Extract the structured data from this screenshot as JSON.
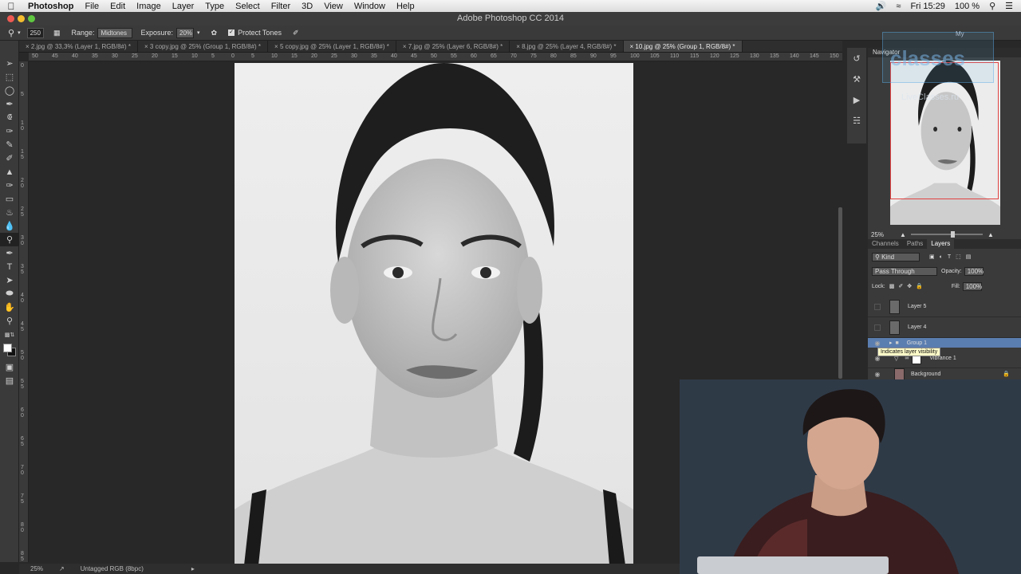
{
  "menubar": {
    "app": "Photoshop",
    "items": [
      "File",
      "Edit",
      "Image",
      "Layer",
      "Type",
      "Select",
      "Filter",
      "3D",
      "View",
      "Window",
      "Help"
    ],
    "clock": "Fri 15:29",
    "battery": "100 %"
  },
  "window": {
    "title": "Adobe Photoshop CC 2014"
  },
  "options": {
    "brush_size": "250",
    "range_label": "Range:",
    "range_value": "Midtones",
    "exposure_label": "Exposure:",
    "exposure_value": "20%",
    "protect_tones": "Protect Tones"
  },
  "tabs": [
    {
      "label": "2.jpg @ 33,3% (Layer 1, RGB/8#) *"
    },
    {
      "label": "3 copy.jpg @ 25% (Group 1, RGB/8#) *"
    },
    {
      "label": "5 copy.jpg @ 25% (Layer 1, RGB/8#) *"
    },
    {
      "label": "7.jpg @ 25% (Layer 6, RGB/8#) *"
    },
    {
      "label": "8.jpg @ 25% (Layer 4, RGB/8#) *"
    },
    {
      "label": "10.jpg @ 25% (Group 1, RGB/8#) *"
    }
  ],
  "ruler_h": [
    "50",
    "45",
    "40",
    "35",
    "30",
    "25",
    "20",
    "15",
    "10",
    "5",
    "0",
    "5",
    "10",
    "15",
    "20",
    "25",
    "30",
    "35",
    "40",
    "45",
    "50",
    "55",
    "60",
    "65",
    "70",
    "75",
    "80",
    "85",
    "90",
    "95",
    "100",
    "105",
    "110",
    "115",
    "120",
    "125",
    "130",
    "135",
    "140",
    "145",
    "150"
  ],
  "ruler_v": [
    "0",
    "5",
    "1 0",
    "1 5",
    "2 0",
    "2 5",
    "3 0",
    "3 5",
    "4 0",
    "4 5",
    "5 0",
    "5 5",
    "6 0",
    "6 5",
    "7 0",
    "7 5",
    "8 0",
    "8 5"
  ],
  "status": {
    "zoom": "25%",
    "profile": "Untagged RGB (8bpc)"
  },
  "navigator": {
    "title": "Navigator",
    "zoom": "25%"
  },
  "panel_tabs": [
    "Channels",
    "Paths",
    "Layers"
  ],
  "layers_panel": {
    "filter": "Kind",
    "blend_mode": "Pass Through",
    "opacity_label": "Opacity:",
    "opacity": "100%",
    "lock_label": "Lock:",
    "fill_label": "Fill:",
    "fill": "100%",
    "layers": [
      {
        "name": "Layer 5"
      },
      {
        "name": "Layer 4"
      },
      {
        "name": "Group 1"
      },
      {
        "name": "Vibrance 1"
      },
      {
        "name": "Background"
      }
    ],
    "tooltip": "Indicates layer visibility"
  },
  "watermark": {
    "line1": "My",
    "line2": "classes",
    "line3": "LiveClasses.ru"
  },
  "colors": {
    "accent": "#4a6fa5",
    "tooltip_bg": "#fdfbc8",
    "nav_frame": "#e24242"
  }
}
